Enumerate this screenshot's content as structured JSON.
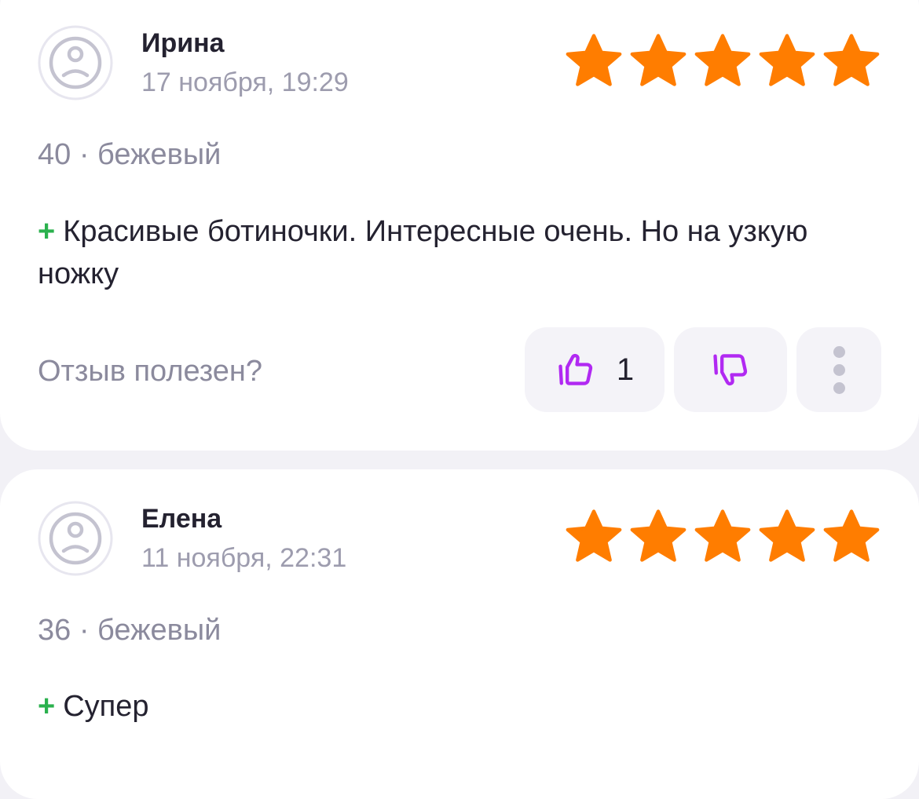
{
  "colors": {
    "background": "#f2f1f6",
    "card": "#ffffff",
    "star": "#ff7d00",
    "plus": "#2bb14e",
    "vote_icon": "#b129f2",
    "muted_text": "#8b8a9d"
  },
  "reviews": [
    {
      "author": "Ирина",
      "date": "17 ноября, 19:29",
      "rating": 5,
      "variant": "40 · бежевый",
      "plus_sign": "+",
      "text": "Красивые ботиночки. Интересные очень. Но на узкую ножку",
      "helpful_question": "Отзыв полезен?",
      "likes": "1",
      "avatar_icon": "sad-face-icon",
      "like_icon": "thumbs-up-icon",
      "dislike_icon": "thumbs-down-icon",
      "more_icon": "more-vertical-icon"
    },
    {
      "author": "Елена",
      "date": "11 ноября, 22:31",
      "rating": 5,
      "variant": "36 · бежевый",
      "plus_sign": "+",
      "text": "Супер",
      "avatar_icon": "sad-face-icon"
    }
  ]
}
